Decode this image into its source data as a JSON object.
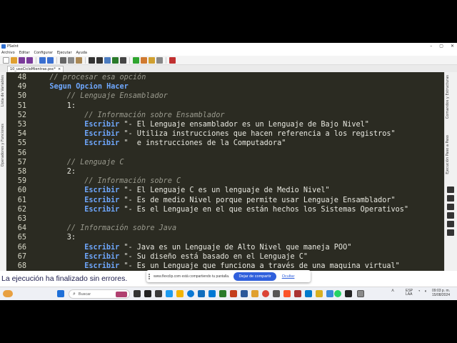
{
  "window": {
    "title": "PSeInt"
  },
  "menu": [
    "Archivo",
    "Editar",
    "Configurar",
    "Ejecutar",
    "Ayuda"
  ],
  "tab": {
    "label": "10_usoCicloMientras.psc*",
    "close": "×"
  },
  "left_panel": {
    "items": [
      "Lista de Variables",
      "Operadores y Funciones"
    ]
  },
  "right_panel": {
    "items": [
      "Comandos y Estructuras",
      "Ejecución Paso a Paso"
    ]
  },
  "editor": {
    "lines": [
      {
        "n": "48",
        "indent": 1,
        "tokens": [
          {
            "t": "comment",
            "v": "// procesar esa opción"
          }
        ]
      },
      {
        "n": "49",
        "indent": 1,
        "tokens": [
          {
            "t": "kw",
            "v": "Segun Opcion Hacer"
          }
        ]
      },
      {
        "n": "50",
        "indent": 2,
        "tokens": [
          {
            "t": "comment",
            "v": "// Lenguaje Ensamblador"
          }
        ]
      },
      {
        "n": "51",
        "indent": 2,
        "tokens": [
          {
            "t": "num",
            "v": "1:"
          }
        ]
      },
      {
        "n": "52",
        "indent": 3,
        "tokens": [
          {
            "t": "comment",
            "v": "// Información sobre Ensamblador"
          }
        ]
      },
      {
        "n": "53",
        "indent": 3,
        "tokens": [
          {
            "t": "kw",
            "v": "Escribir"
          },
          {
            "t": "str",
            "v": " \"- El Lenguaje ensamblador es un Lenguaje de Bajo Nivel\""
          }
        ]
      },
      {
        "n": "54",
        "indent": 3,
        "tokens": [
          {
            "t": "kw",
            "v": "Escribir"
          },
          {
            "t": "str",
            "v": " \"- Utiliza instrucciones que hacen referencia a los registros\""
          }
        ]
      },
      {
        "n": "55",
        "indent": 3,
        "tokens": [
          {
            "t": "kw",
            "v": "Escribir"
          },
          {
            "t": "str",
            "v": " \"  e instrucciones de la Computadora\""
          }
        ]
      },
      {
        "n": "56",
        "indent": 0,
        "tokens": []
      },
      {
        "n": "57",
        "indent": 2,
        "tokens": [
          {
            "t": "comment",
            "v": "// Lenguaje C"
          }
        ]
      },
      {
        "n": "58",
        "indent": 2,
        "tokens": [
          {
            "t": "num",
            "v": "2:"
          }
        ]
      },
      {
        "n": "59",
        "indent": 3,
        "tokens": [
          {
            "t": "comment",
            "v": "// Información sobre C"
          }
        ]
      },
      {
        "n": "60",
        "indent": 3,
        "tokens": [
          {
            "t": "kw",
            "v": "Escribir"
          },
          {
            "t": "str",
            "v": " \"- El Lenguaje C es un lenguaje de Medio Nivel\""
          }
        ]
      },
      {
        "n": "61",
        "indent": 3,
        "tokens": [
          {
            "t": "kw",
            "v": "Escribir"
          },
          {
            "t": "str",
            "v": " \"- Es de medio Nivel porque permite usar Lenguaje Ensamblador\""
          }
        ]
      },
      {
        "n": "62",
        "indent": 3,
        "tokens": [
          {
            "t": "kw",
            "v": "Escribir"
          },
          {
            "t": "str",
            "v": " \"- Es el Lenguaje en el que están hechos los Sistemas Operativos\""
          }
        ]
      },
      {
        "n": "63",
        "indent": 0,
        "tokens": []
      },
      {
        "n": "64",
        "indent": 2,
        "tokens": [
          {
            "t": "comment",
            "v": "// Información sobre Java"
          }
        ]
      },
      {
        "n": "65",
        "indent": 2,
        "tokens": [
          {
            "t": "num",
            "v": "3:"
          }
        ]
      },
      {
        "n": "66",
        "indent": 3,
        "tokens": [
          {
            "t": "kw",
            "v": "Escribir"
          },
          {
            "t": "str",
            "v": " \"- Java es un Lenguaje de Alto Nivel que maneja POO\""
          }
        ]
      },
      {
        "n": "67",
        "indent": 3,
        "tokens": [
          {
            "t": "kw",
            "v": "Escribir"
          },
          {
            "t": "str",
            "v": " \"- Su diseño está basado en el Lenguaje C\""
          }
        ]
      },
      {
        "n": "68",
        "indent": 3,
        "tokens": [
          {
            "t": "kw",
            "v": "Escribir"
          },
          {
            "t": "str",
            "v": " \"- Es un Lenguaje que funciona a través de una maquina virtual\""
          }
        ]
      }
    ]
  },
  "status": {
    "message": "La ejecución ha finalizado sin errores."
  },
  "share_banner": {
    "text": "www.flexclip.com está compartiendo tu pantalla.",
    "stop_label": "Dejar de compartir",
    "hide_label": "Ocultar"
  },
  "taskbar": {
    "search_placeholder": "Buscar",
    "language": "ESP",
    "language_sub": "LAA",
    "time": "09:03 p. m.",
    "date": "15/08/2024"
  },
  "colors": {
    "editor_bg": "#2b2b22",
    "keyword": "#6fa8ff",
    "comment": "#9a9a8e",
    "text": "#e8e8e0",
    "status_text": "#1a1a4a",
    "share_button": "#2f5fdc"
  }
}
